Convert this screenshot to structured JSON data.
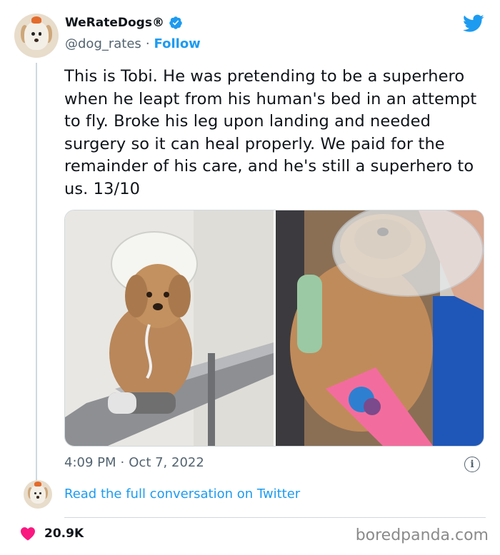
{
  "account": {
    "display_name": "WeRateDogs®",
    "handle": "@dog_rates",
    "separator": "·",
    "follow_label": "Follow",
    "verified_icon": "verified-badge-icon",
    "brand_icon": "twitter-bird-icon"
  },
  "tweet": {
    "text": "This is Tobi. He was pretending to be a superhero when he leapt from his human's bed in an attempt to fly. Broke his leg upon landing and needed surgery so it can heal properly. We paid for the remainder of his care, and he's still a superhero to us. 13/10",
    "time": "4:09 PM",
    "date_separator": "·",
    "date": "Oct 7, 2022"
  },
  "media": {
    "photos": [
      {
        "subject": "dog-in-cone-on-vet-table-photo"
      },
      {
        "subject": "dog-with-pink-cast-held-photo"
      }
    ]
  },
  "conversation": {
    "link_label": "Read the full conversation on Twitter"
  },
  "engagement": {
    "likes": "20.9K"
  },
  "watermark": "boredpanda.com",
  "colors": {
    "accent": "#1d9bf0",
    "text": "#0f1419",
    "muted": "#536471",
    "heart": "#f91880",
    "border": "#cfd9de"
  }
}
